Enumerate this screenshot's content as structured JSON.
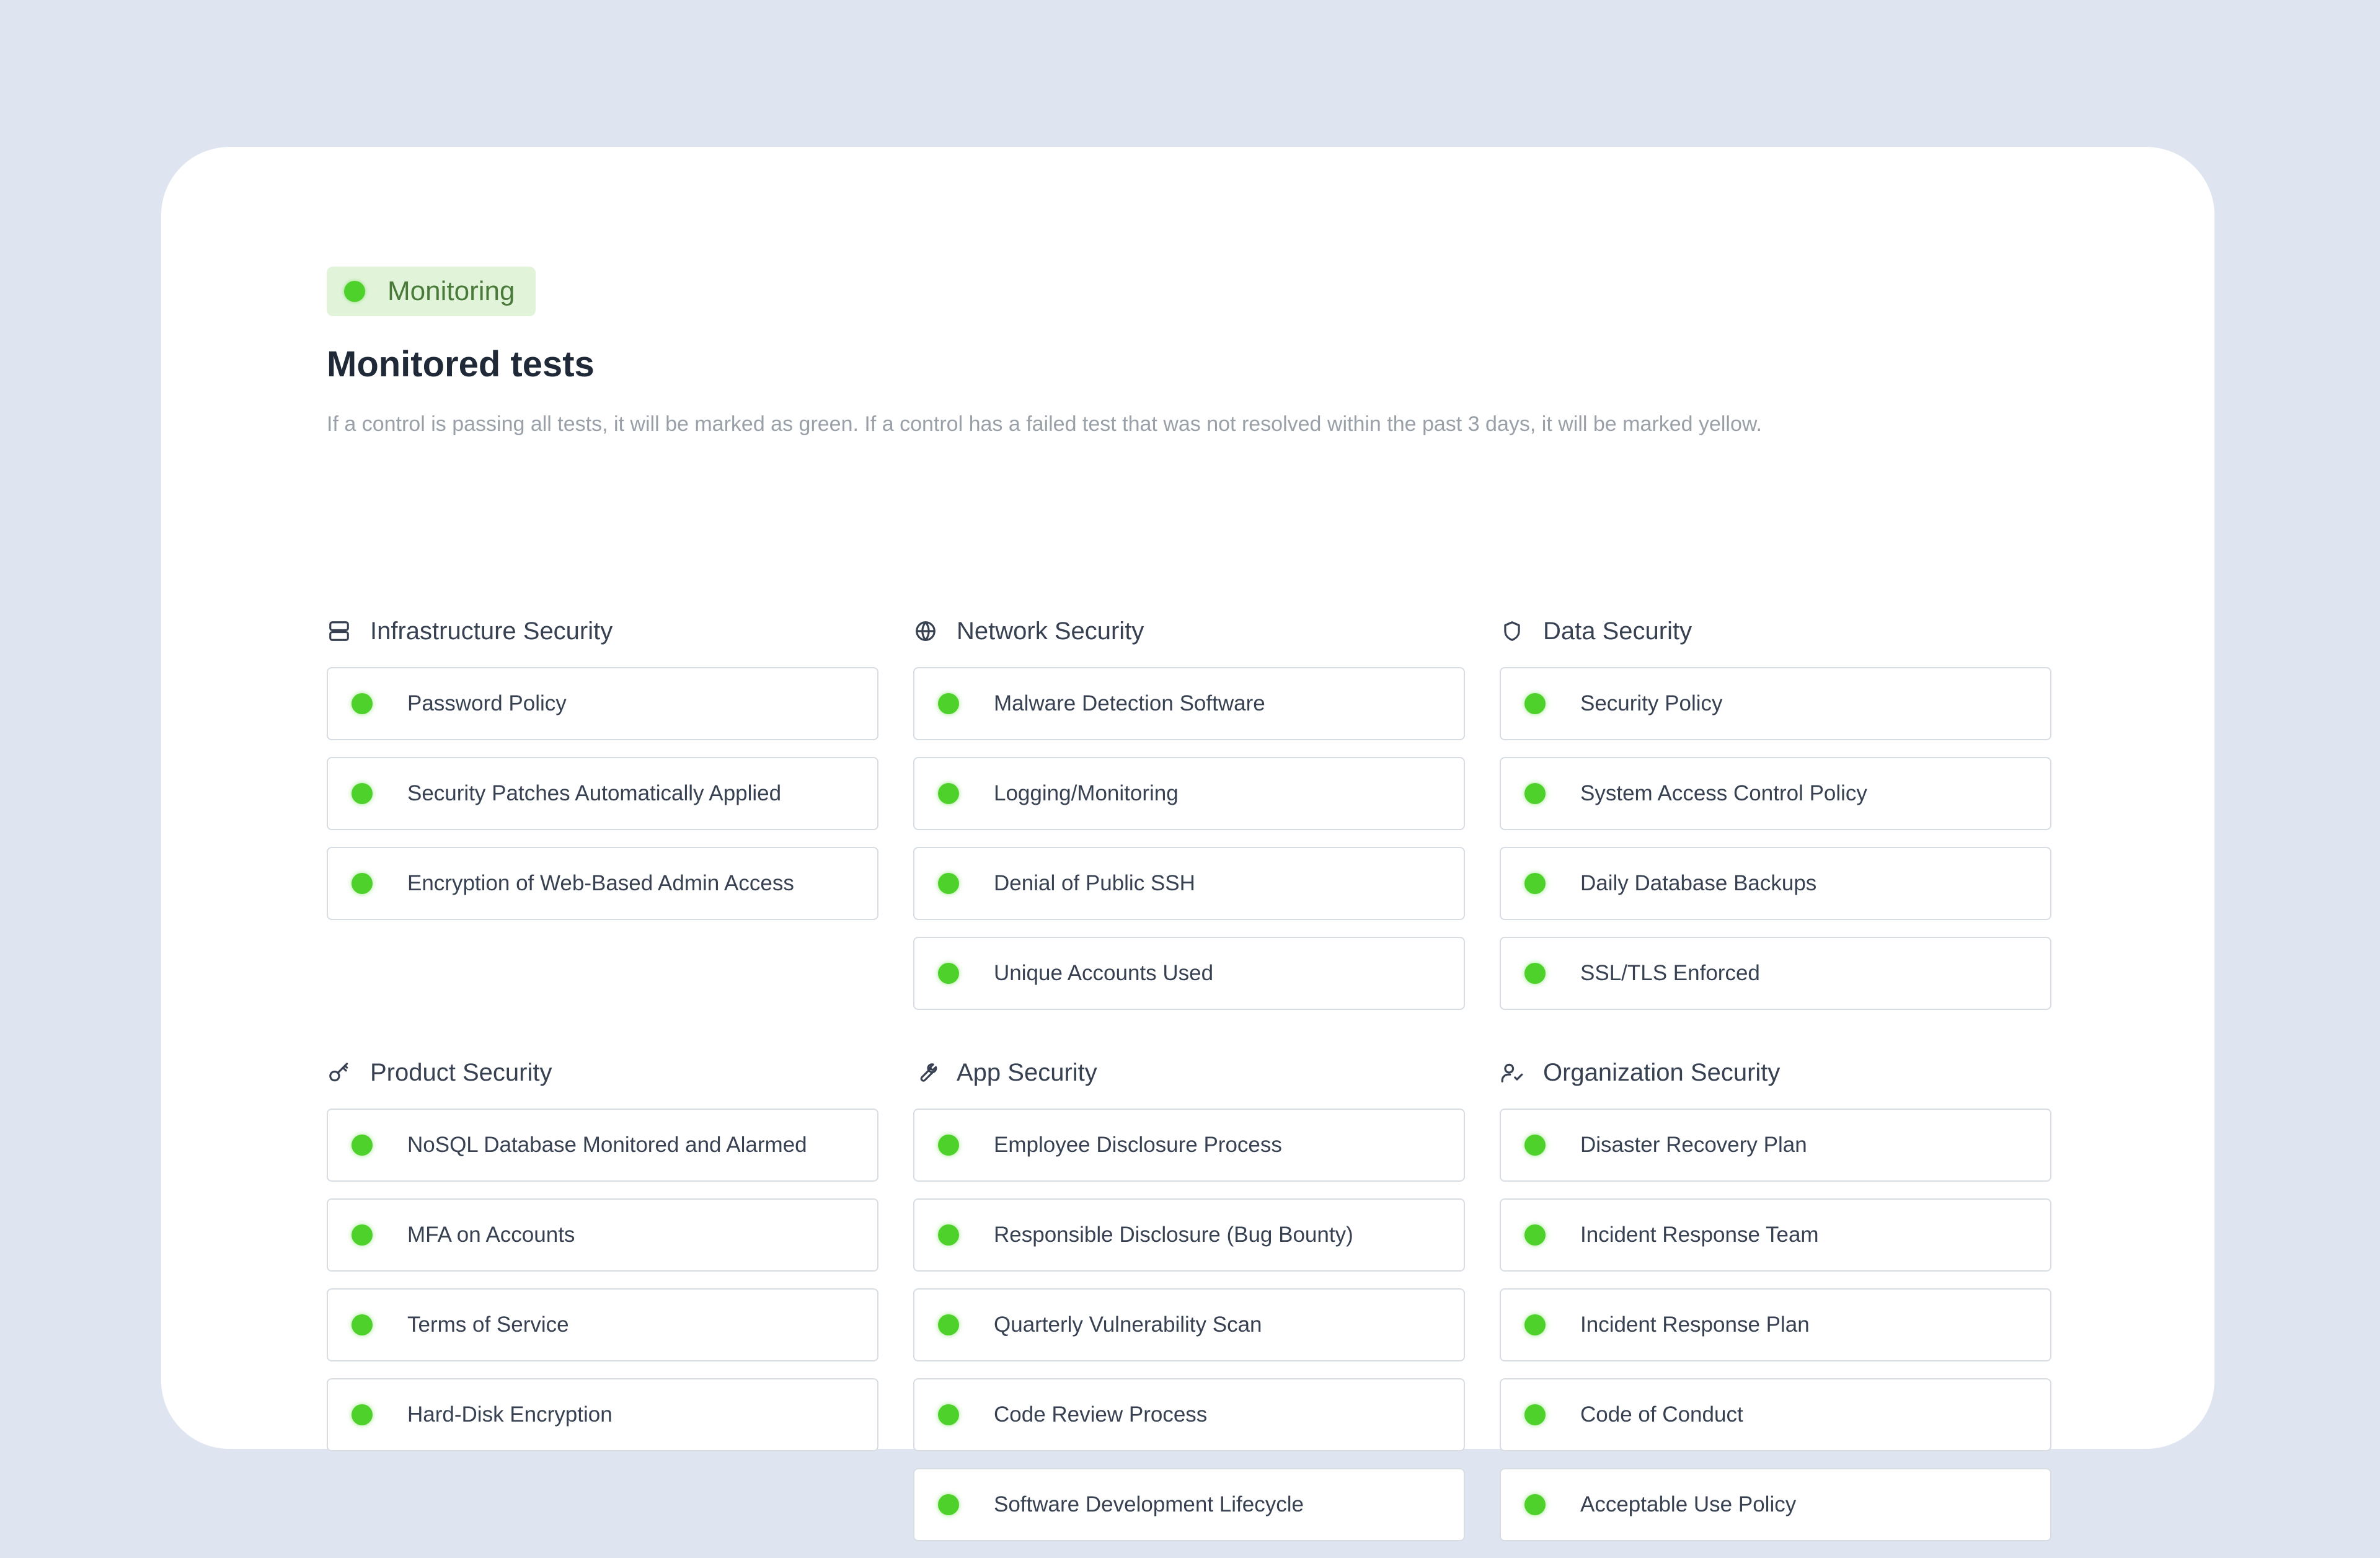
{
  "badge": {
    "label": "Monitoring",
    "status_color": "#4fd12b"
  },
  "title": "Monitored tests",
  "description": "If a control is passing all tests, it will be marked as green. If a control has a failed test that was not resolved within the past 3 days, it will be marked yellow.",
  "sections": [
    {
      "title": "Infrastructure Security",
      "icon": "server-icon",
      "items": [
        {
          "label": "Password Policy",
          "status": "green"
        },
        {
          "label": "Security Patches Automatically Applied",
          "status": "green"
        },
        {
          "label": "Encryption of Web-Based Admin Access",
          "status": "green"
        }
      ]
    },
    {
      "title": "Network Security",
      "icon": "globe-icon",
      "items": [
        {
          "label": "Malware Detection Software",
          "status": "green"
        },
        {
          "label": "Logging/Monitoring",
          "status": "green"
        },
        {
          "label": "Denial of Public SSH",
          "status": "green"
        },
        {
          "label": "Unique Accounts Used",
          "status": "green"
        }
      ]
    },
    {
      "title": "Data Security",
      "icon": "shield-icon",
      "items": [
        {
          "label": "Security Policy",
          "status": "green"
        },
        {
          "label": "System Access Control Policy",
          "status": "green"
        },
        {
          "label": "Daily Database Backups",
          "status": "green"
        },
        {
          "label": "SSL/TLS Enforced",
          "status": "green"
        }
      ]
    },
    {
      "title": "Product Security",
      "icon": "key-icon",
      "items": [
        {
          "label": "NoSQL Database Monitored and Alarmed",
          "status": "green"
        },
        {
          "label": "MFA on Accounts",
          "status": "green"
        },
        {
          "label": "Terms of Service",
          "status": "green"
        },
        {
          "label": "Hard-Disk Encryption",
          "status": "green"
        }
      ]
    },
    {
      "title": "App Security",
      "icon": "wrench-icon",
      "items": [
        {
          "label": "Employee Disclosure Process",
          "status": "green"
        },
        {
          "label": "Responsible Disclosure (Bug Bounty)",
          "status": "green"
        },
        {
          "label": "Quarterly Vulnerability Scan",
          "status": "green"
        },
        {
          "label": "Code Review Process",
          "status": "green"
        },
        {
          "label": "Software Development Lifecycle",
          "status": "green"
        }
      ]
    },
    {
      "title": "Organization Security",
      "icon": "user-check-icon",
      "items": [
        {
          "label": "Disaster Recovery Plan",
          "status": "green"
        },
        {
          "label": "Incident Response Team",
          "status": "green"
        },
        {
          "label": "Incident Response Plan",
          "status": "green"
        },
        {
          "label": "Code of Conduct",
          "status": "green"
        },
        {
          "label": "Acceptable Use Policy",
          "status": "green"
        }
      ]
    }
  ]
}
